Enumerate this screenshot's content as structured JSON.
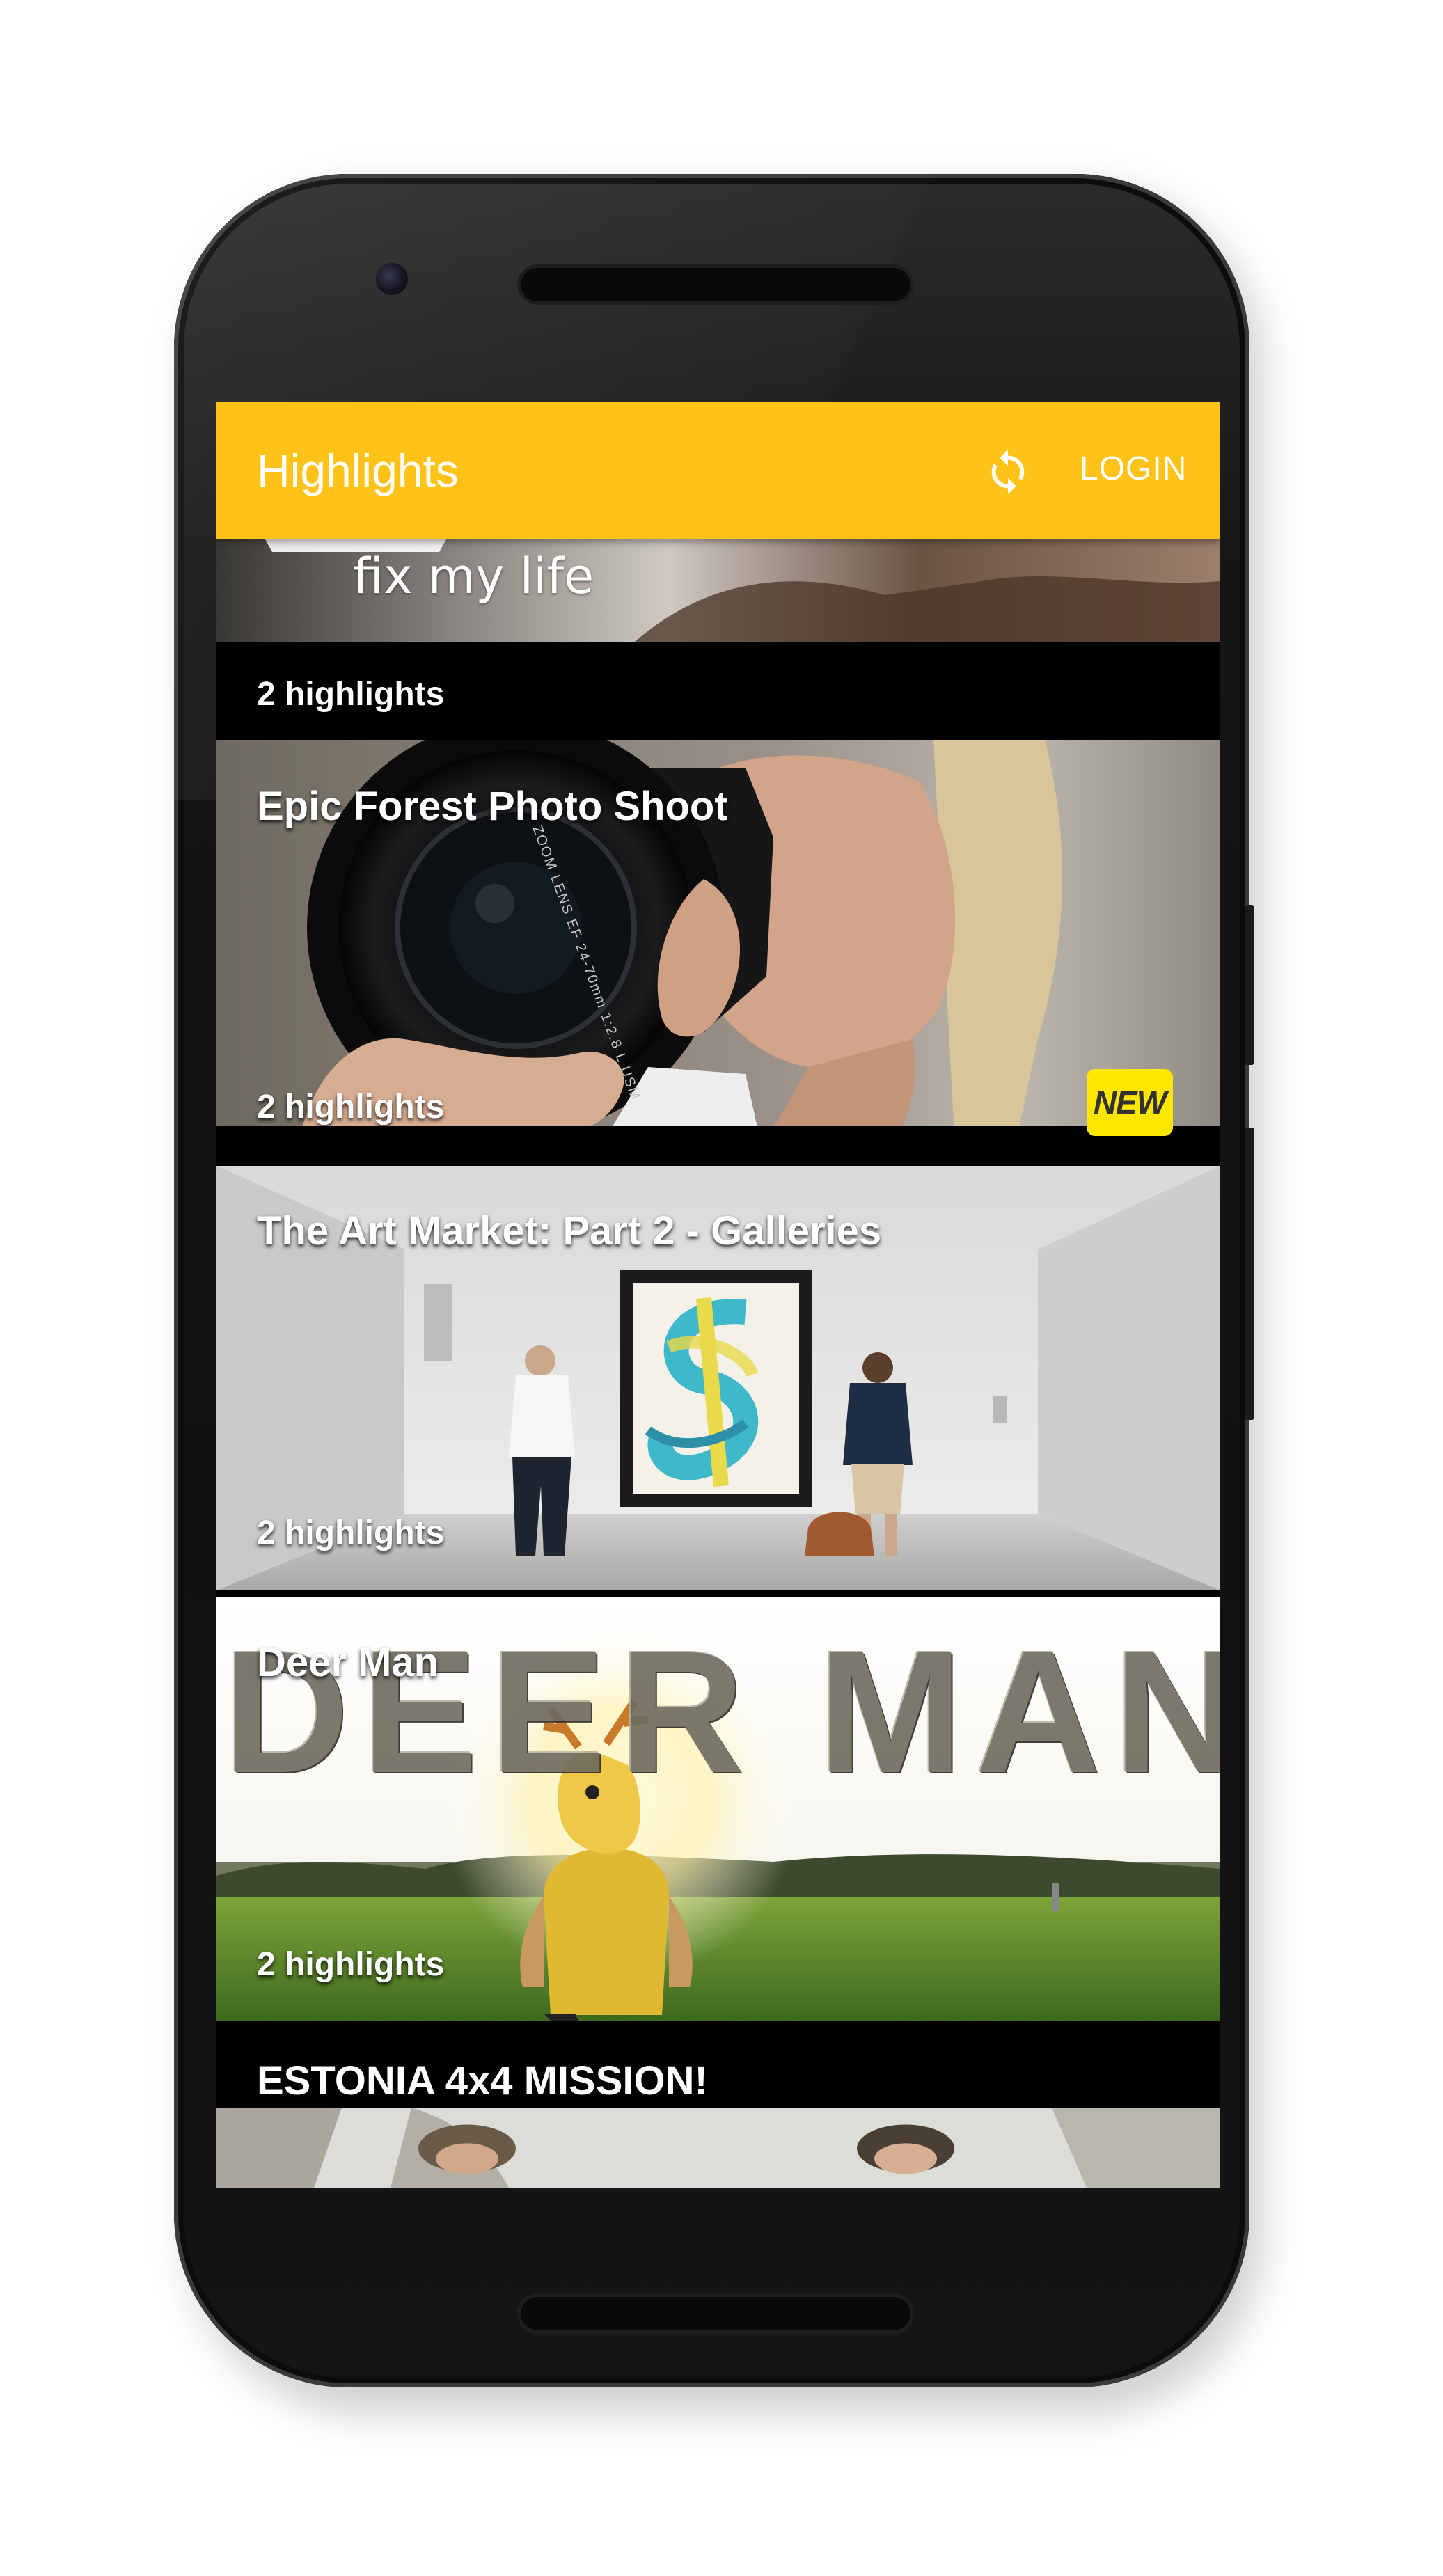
{
  "app_bar": {
    "title": "Highlights",
    "refresh_icon": "refresh-icon",
    "login_label": "LOGIN",
    "color": "#ffc218"
  },
  "partial_top_card": {
    "image_text": "fix my life",
    "count": "2 highlights"
  },
  "cards": [
    {
      "title": "Epic Forest Photo Shoot",
      "count": "2 highlights",
      "badge": "NEW"
    },
    {
      "title": "The Art Market: Part 2 - Galleries",
      "count": "2 highlights"
    },
    {
      "title": "Deer Man",
      "count": "2 highlights",
      "image_text": "DEER MAN"
    },
    {
      "title": "ESTONIA 4x4 MISSION!"
    }
  ],
  "lens_text": "ZOOM LENS EF 24-70mm 1:2.8 L USM"
}
